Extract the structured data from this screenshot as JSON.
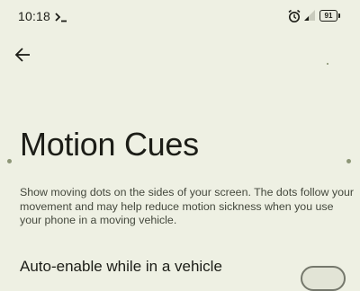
{
  "status_bar": {
    "time": "10:18",
    "battery": "91",
    "icons": [
      "terminal-icon",
      "alarm-icon",
      "signal-icon",
      "battery-icon"
    ]
  },
  "header": {
    "back_icon": "arrow-left-icon"
  },
  "page": {
    "title": "Motion Cues",
    "description": "Show moving dots on the sides of your screen. The dots follow your movement and may help reduce motion sickness when you use your phone in a moving vehicle."
  },
  "settings": [
    {
      "label": "Auto-enable while in a vehicle",
      "toggle_on": false
    }
  ],
  "colors": {
    "background": "#eef0e3",
    "text": "#1c1d17",
    "secondary_text": "#44483d",
    "dot": "#8d9677"
  }
}
